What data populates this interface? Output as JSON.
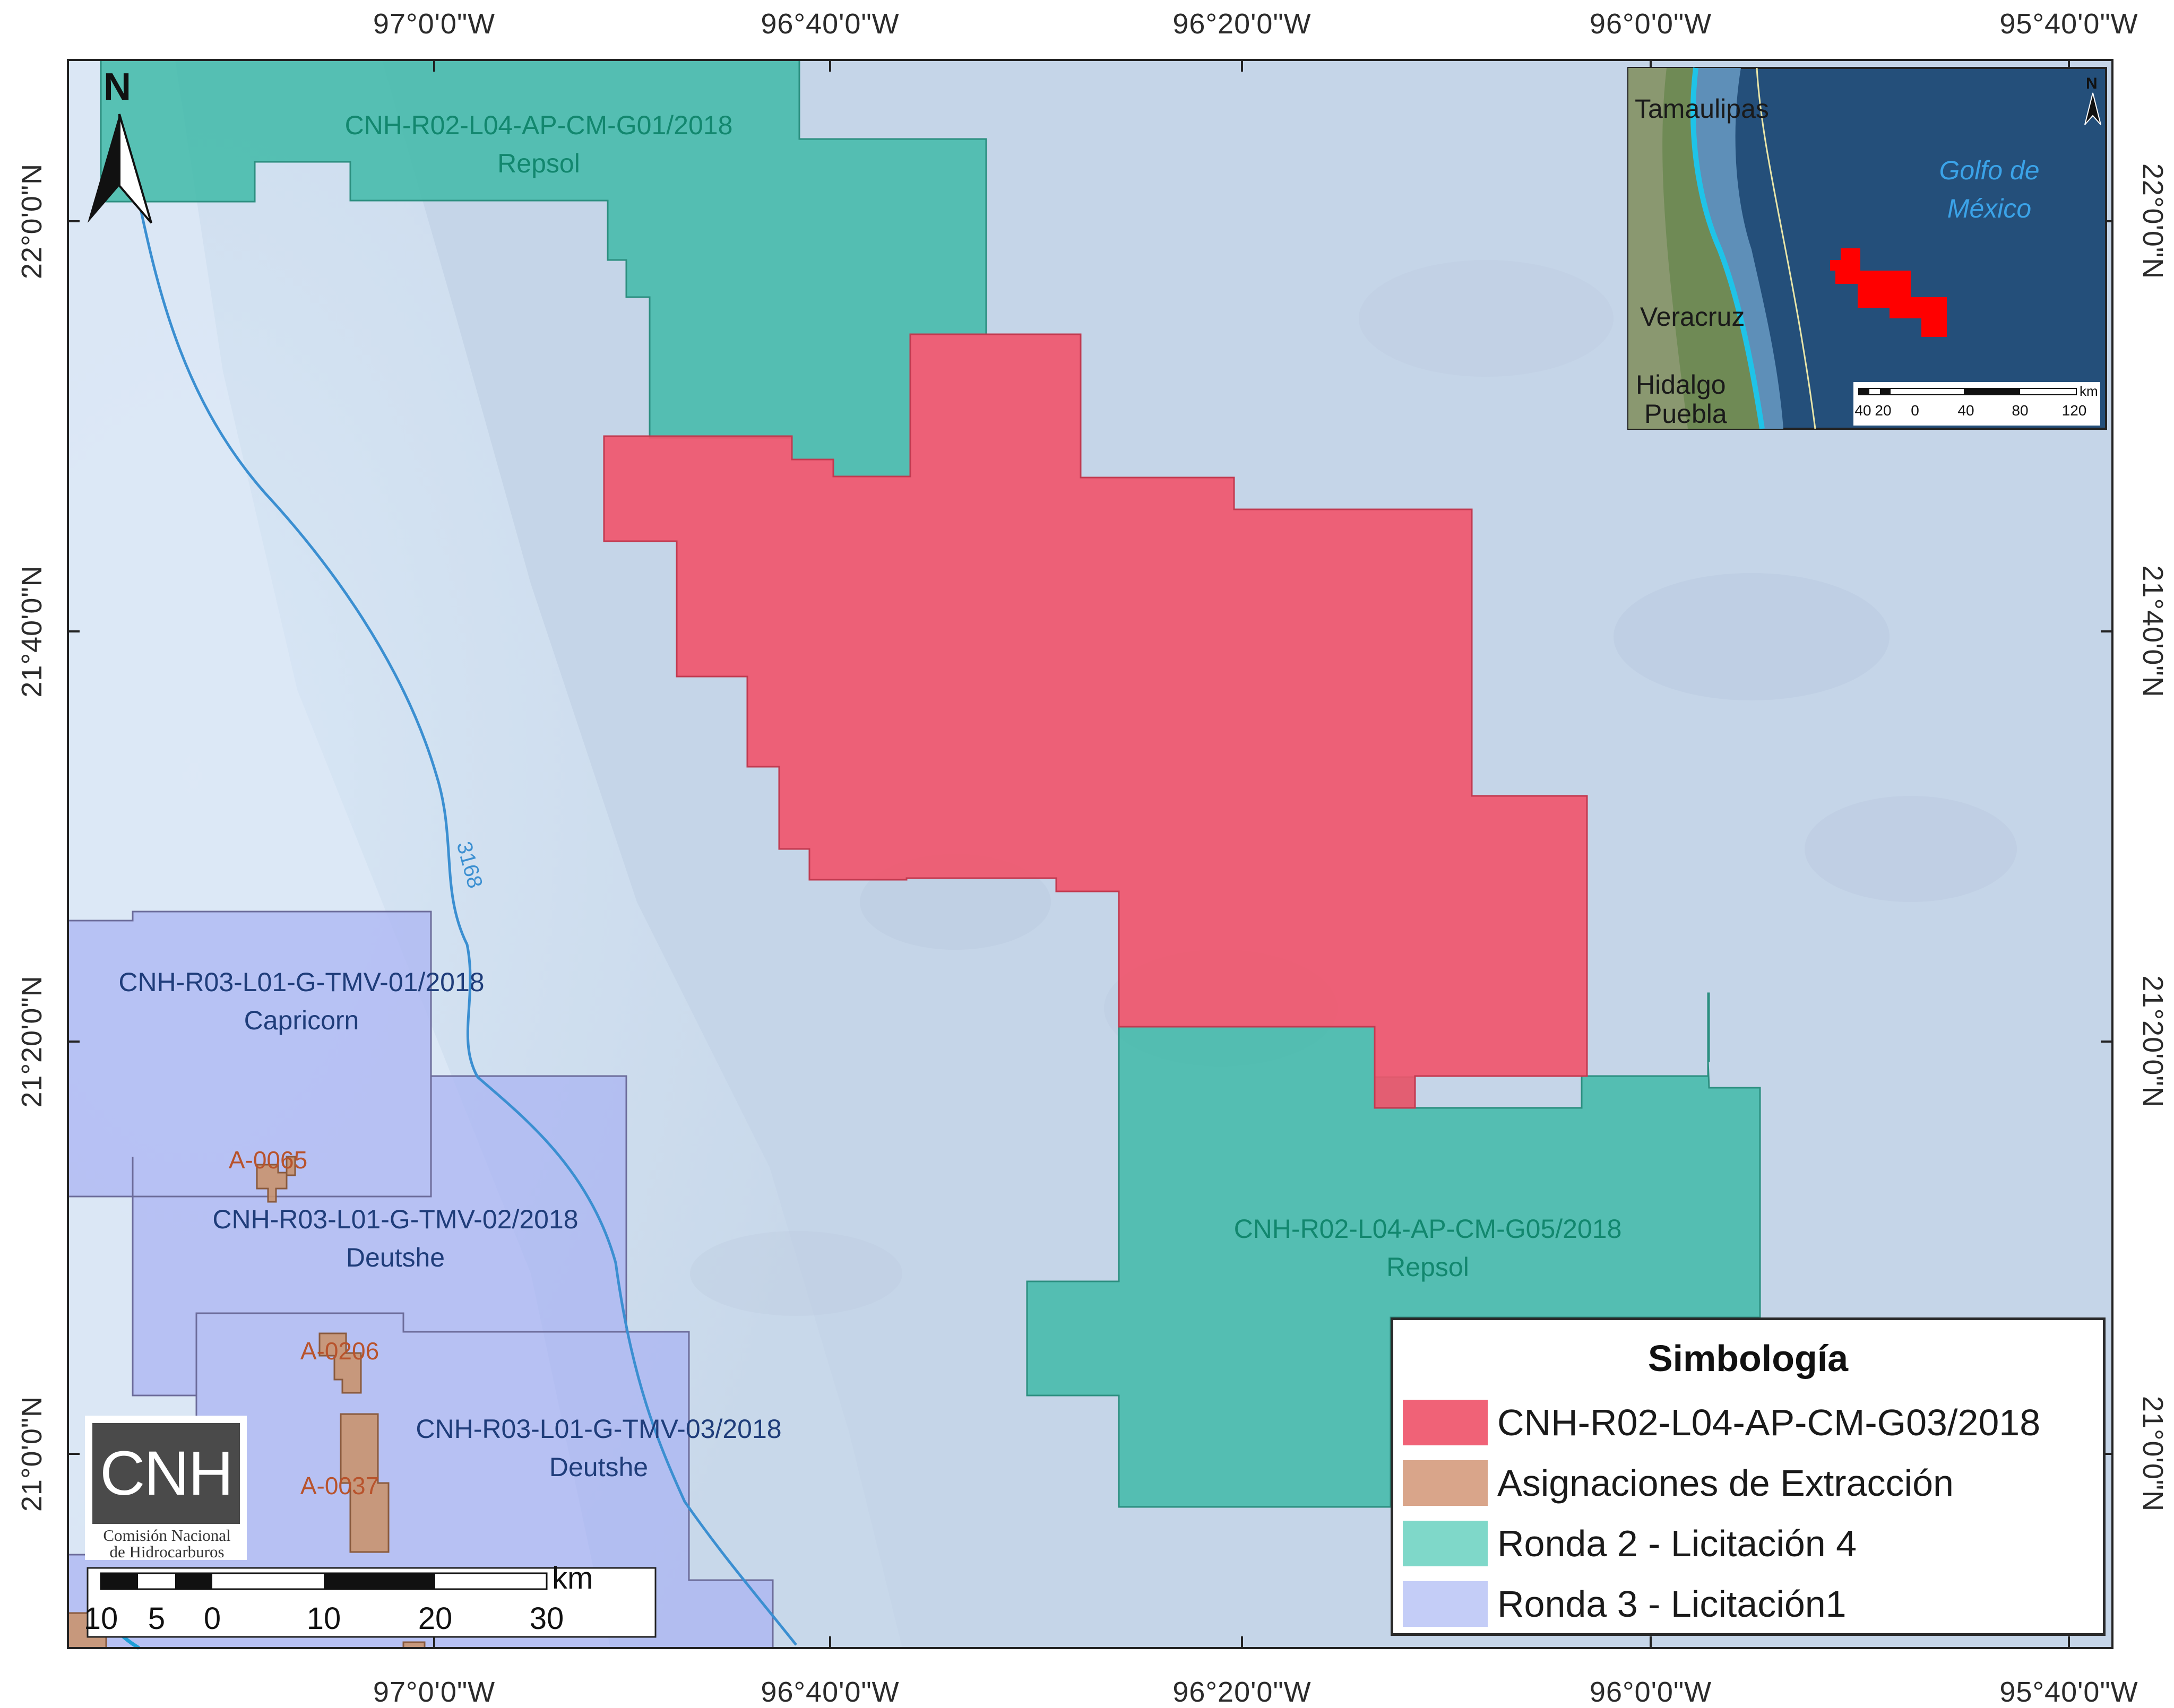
{
  "coordinates": {
    "longitude_labels": [
      "97°0'0\"W",
      "96°40'0\"W",
      "96°20'0\"W",
      "96°0'0\"W",
      "95°40'0\"W"
    ],
    "latitude_labels": [
      "22°0'0\"N",
      "21°40'0\"N",
      "21°20'0\"N",
      "21°0'0\"N"
    ]
  },
  "north_arrow": {
    "label": "N"
  },
  "blocks": {
    "g01": {
      "code": "CNH-R02-L04-AP-CM-G01/2018",
      "operator": "Repsol"
    },
    "g05": {
      "code": "CNH-R02-L04-AP-CM-G05/2018",
      "operator": "Repsol"
    },
    "tmv01": {
      "code": "CNH-R03-L01-G-TMV-01/2018",
      "operator": "Capricorn"
    },
    "tmv02": {
      "code": "CNH-R03-L01-G-TMV-02/2018",
      "operator": "Deutshe"
    },
    "tmv03": {
      "code": "CNH-R03-L01-G-TMV-03/2018",
      "operator": "Deutshe"
    }
  },
  "assignments": [
    "A-0065",
    "A-0206",
    "A-0037"
  ],
  "contour_label": "3168",
  "inset": {
    "labels": [
      "Tamaulipas",
      "Veracruz",
      "Hidalgo",
      "Puebla"
    ],
    "sea_label_line1": "Golfo de",
    "sea_label_line2": "México",
    "north_label": "N",
    "scale_unit": "km",
    "scale_ticks": [
      "40",
      "20",
      "0",
      "40",
      "80",
      "120"
    ]
  },
  "scale_bar": {
    "unit": "km",
    "ticks": [
      "10",
      "5",
      "0",
      "10",
      "20",
      "30"
    ]
  },
  "logo": {
    "text": "CNH",
    "subtitle_line1": "Comisión Nacional",
    "subtitle_line2": "de Hidrocarburos"
  },
  "legend": {
    "title": "Simbología",
    "items": [
      {
        "label": "CNH-R02-L04-AP-CM-G03/2018",
        "color": "#f06277"
      },
      {
        "label": "Asignaciones de Extracción",
        "color": "#d9a58a"
      },
      {
        "label": "Ronda 2 - Licitación 4",
        "color": "#7fd8c9"
      },
      {
        "label": "Ronda 3 - Licitación1",
        "color": "#c4cdf7"
      }
    ]
  },
  "colors": {
    "sea": "#c9d9ea",
    "shelf": "#d6e6f5",
    "target_block": "#f0566c",
    "ronda2": "#48bfae",
    "ronda3": "#a9b3f2",
    "assignment": "#c9946f",
    "coast_line": "#3b8fd1"
  }
}
